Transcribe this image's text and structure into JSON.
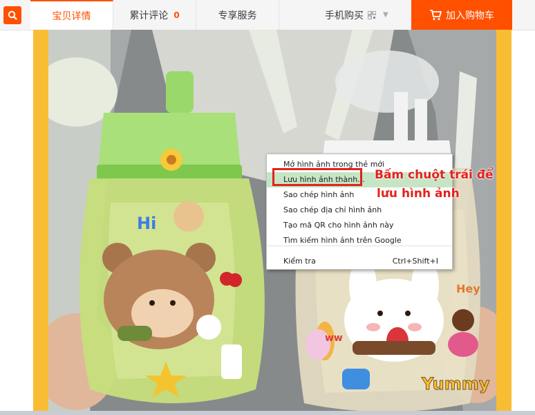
{
  "tabs": [
    {
      "label": "宝贝详情"
    },
    {
      "label": "累计评论",
      "count": "0"
    },
    {
      "label": "专享服务"
    }
  ],
  "mobile_buy": {
    "label": "手机购买"
  },
  "cart_button": {
    "label": "加入购物车"
  },
  "photo": {
    "sticker_hi": "Hi",
    "sticker_yummy": "Yummy",
    "sticker_hey": "Hey",
    "sticker_ww": "ww"
  },
  "context_menu": {
    "items": [
      {
        "label": "Mở hình ảnh trong thẻ mới"
      },
      {
        "label": "Lưu hình ảnh thành..."
      },
      {
        "label": "Sao chép hình ảnh"
      },
      {
        "label": "Sao chép địa chỉ hình ảnh"
      },
      {
        "label": "Tạo mã QR cho hình ảnh này"
      },
      {
        "label": "Tìm kiếm hình ảnh trên Google"
      },
      {
        "label": "Kiểm tra",
        "shortcut": "Ctrl+Shift+I"
      }
    ]
  },
  "annotation": {
    "line1": "Bấm chuột trái để",
    "line2": "lưu hình ảnh"
  },
  "colors": {
    "accent": "#ff5000",
    "annotation": "#e3221c",
    "highlight": "#c5e5c4"
  }
}
